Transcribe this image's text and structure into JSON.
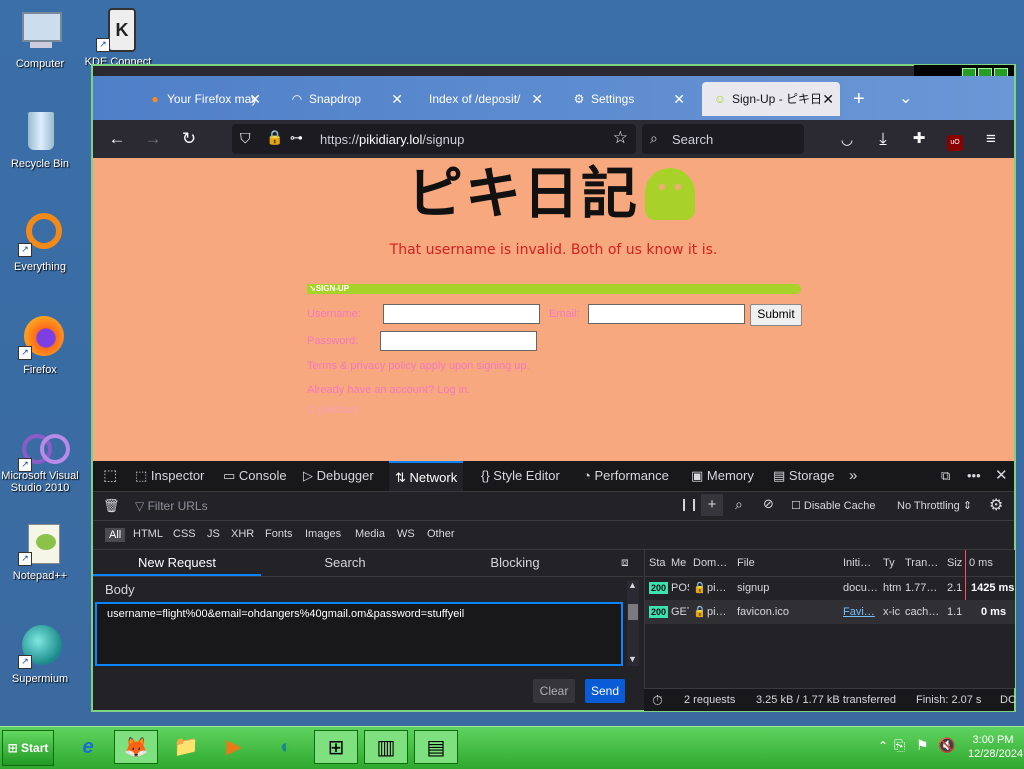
{
  "desktop": {
    "icons": [
      {
        "label": "Computer",
        "glyph": "🖥"
      },
      {
        "label": "KDE Connect",
        "glyph": "K"
      },
      {
        "label": "Recycle Bin",
        "glyph": "🗑"
      },
      {
        "label": "Everything",
        "glyph": "○"
      },
      {
        "label": "Firefox",
        "glyph": "🦊"
      },
      {
        "label": "Microsoft Visual Studio 2010",
        "glyph": "∞"
      },
      {
        "label": "Notepad++",
        "glyph": "✎"
      },
      {
        "label": "Supermium",
        "glyph": "◐"
      }
    ]
  },
  "browser": {
    "tabs": [
      {
        "title": "Your Firefox may",
        "icon": "firefox-icon"
      },
      {
        "title": "Snapdrop",
        "icon": "wifi-icon"
      },
      {
        "title": "Index of /deposit/",
        "icon": ""
      },
      {
        "title": "Settings",
        "icon": "gear-icon"
      },
      {
        "title": "Sign-Up - ピキ日",
        "icon": "ghost-icon"
      }
    ],
    "new_tab": "+",
    "tab_list": "⌄",
    "url_prefix": "https://",
    "url_host": "pikidiary.lol",
    "url_path": "/signup",
    "search_label": "Search"
  },
  "page": {
    "logo_text": "ピキ日記",
    "error": "That username is invalid. Both of us know it is.",
    "signup_label": "↘SIGN-UP",
    "username_label": "Username:",
    "email_label": "Email:",
    "password_label": "Password:",
    "submit": "Submit",
    "terms_text": "Terms & privacy policy apply upon signing up.",
    "login_text": "Already have an account? Log in.",
    "footer_text": "© pikidiary"
  },
  "devtools": {
    "tabs": [
      "Inspector",
      "Console",
      "Debugger",
      "Network",
      "Style Editor",
      "Performance",
      "Memory",
      "Storage"
    ],
    "active_tab": "Network",
    "filter_placeholder": "Filter URLs",
    "disable_cache": "Disable Cache",
    "throttling": "No Throttling ⇕",
    "types": [
      "All",
      "HTML",
      "CSS",
      "JS",
      "XHR",
      "Fonts",
      "Images",
      "Media",
      "WS",
      "Other"
    ],
    "subtabs": [
      "New Request",
      "Search",
      "Blocking"
    ],
    "body_label": "Body",
    "body_value": "username=flight%00&email=ohdangers%40gmail.om&password=stuffyeil",
    "clear": "Clear",
    "send": "Send",
    "columns": [
      "Sta",
      "Me",
      "Dom…",
      "File",
      "Initi…",
      "Ty",
      "Tran…",
      "Siz",
      "0 ms"
    ],
    "requests": [
      {
        "status": "200",
        "method": "POS",
        "domain": "pi…",
        "file": "signup",
        "initiator": "docu…",
        "type": "htm",
        "transferred": "1.77…",
        "size": "2.1",
        "time": "1425 ms"
      },
      {
        "status": "200",
        "method": "GET",
        "domain": "pi…",
        "file": "favicon.ico",
        "initiator": "Favi…",
        "type": "x-ic",
        "transferred": "cach…",
        "size": "1.1",
        "time": "0 ms"
      }
    ],
    "status": {
      "requests": "2 requests",
      "size": "3.25 kB / 1.77 kB transferred",
      "finish": "Finish: 2.07 s",
      "dc": "DC"
    }
  },
  "taskbar": {
    "start": "Start",
    "apps": [
      "e",
      "🦊",
      "📁",
      "▶",
      "◐",
      "⊞",
      "▥",
      "▤"
    ],
    "time": "3:00 PM",
    "date": "12/28/2024"
  }
}
